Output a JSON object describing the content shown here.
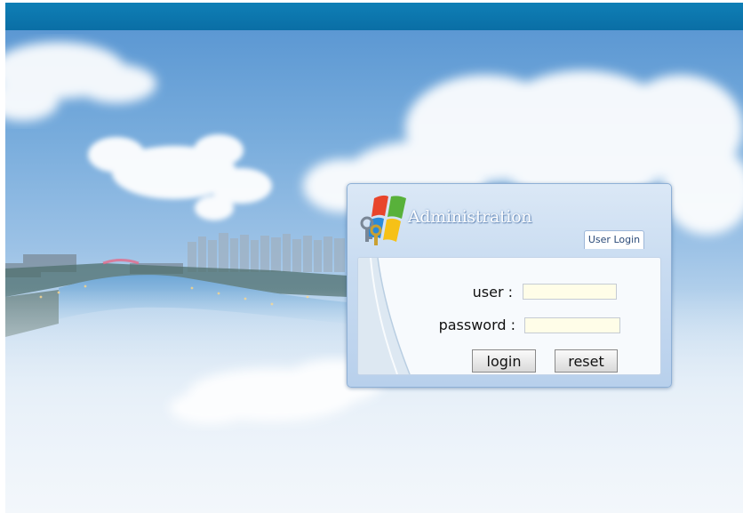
{
  "panel": {
    "title": "Administration",
    "tab_label": "User Login"
  },
  "form": {
    "user_label": "user :",
    "user_value": "",
    "password_label": "password :",
    "password_value": "",
    "login_label": "login",
    "reset_label": "reset"
  },
  "colors": {
    "top_bar": "#0f7fb6",
    "sky": "#78acdc",
    "input_background": "#fffde8"
  },
  "icons": {
    "logo": "windows-keys-logo"
  }
}
